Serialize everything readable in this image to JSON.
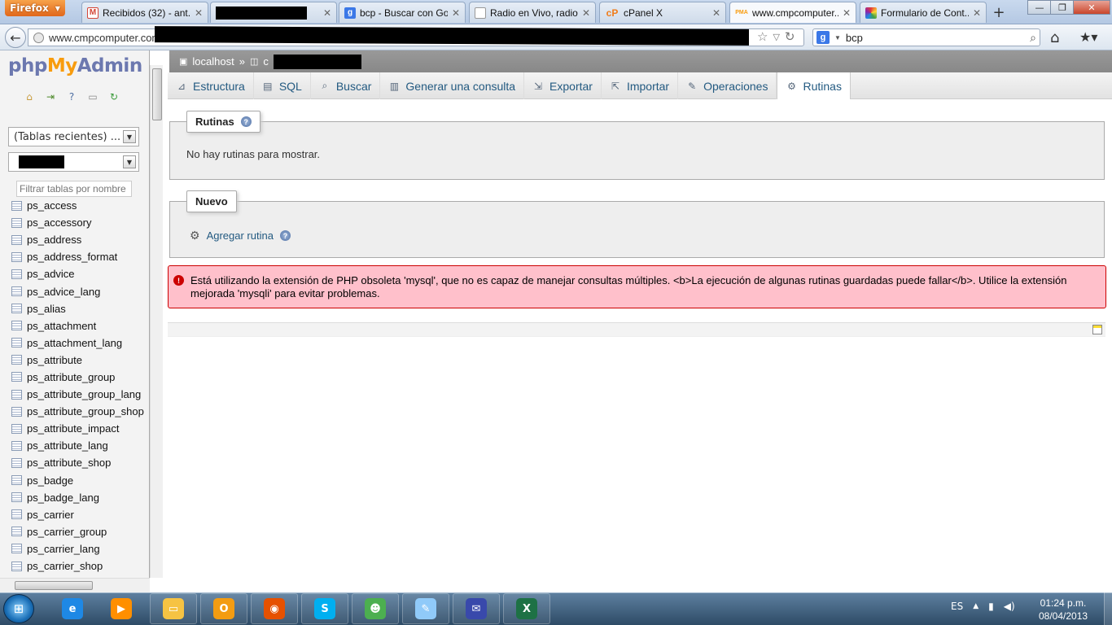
{
  "browser": {
    "menu_label": "Firefox",
    "tabs": [
      {
        "label": "Recibidos (32) - ant...",
        "icon": "gmail-icon",
        "icon_color": "#d44638",
        "icon_glyph": "M"
      },
      {
        "label": "",
        "icon": "redacted",
        "icon_color": "#000000",
        "icon_glyph": ""
      },
      {
        "label": "bcp - Buscar con Go...",
        "icon": "google-icon",
        "icon_color": "#3b78e7",
        "icon_glyph": "g"
      },
      {
        "label": "Radio en Vivo, radio...",
        "icon": "page-icon",
        "icon_color": "#bbbbbb",
        "icon_glyph": ""
      },
      {
        "label": "cPanel X",
        "icon": "cpanel-icon",
        "icon_color": "#f07c1a",
        "icon_glyph": "cP"
      },
      {
        "label": "www.cmpcomputer...",
        "icon": "phpmyadmin-icon",
        "icon_color": "#f89c0e",
        "icon_glyph": "PMA"
      },
      {
        "label": "Formulario de Cont...",
        "icon": "rainbow-icon",
        "icon_color": "#e64a19",
        "icon_glyph": ""
      }
    ],
    "url": "www.cmpcomputer.com",
    "search_value": "bcp",
    "search_engine_glyph": "g"
  },
  "pma": {
    "logo": {
      "php": "php",
      "my": "My",
      "admin": "Admin"
    },
    "recent_tables": "(Tablas recientes) ...",
    "database_select": "",
    "filter_placeholder": "Filtrar tablas por nombre",
    "tables": [
      "ps_access",
      "ps_accessory",
      "ps_address",
      "ps_address_format",
      "ps_advice",
      "ps_advice_lang",
      "ps_alias",
      "ps_attachment",
      "ps_attachment_lang",
      "ps_attribute",
      "ps_attribute_group",
      "ps_attribute_group_lang",
      "ps_attribute_group_shop",
      "ps_attribute_impact",
      "ps_attribute_lang",
      "ps_attribute_shop",
      "ps_badge",
      "ps_badge_lang",
      "ps_carrier",
      "ps_carrier_group",
      "ps_carrier_lang",
      "ps_carrier_shop"
    ],
    "breadcrumb": {
      "server": "localhost",
      "separator": "»",
      "db_prefix": "c"
    },
    "tabs": [
      {
        "label": "Estructura",
        "icon": "structure-icon",
        "glyph": "⊿"
      },
      {
        "label": "SQL",
        "icon": "sql-icon",
        "glyph": "▤"
      },
      {
        "label": "Buscar",
        "icon": "search-icon",
        "glyph": "⌕"
      },
      {
        "label": "Generar una consulta",
        "icon": "query-icon",
        "glyph": "▥"
      },
      {
        "label": "Exportar",
        "icon": "export-icon",
        "glyph": "⇲"
      },
      {
        "label": "Importar",
        "icon": "import-icon",
        "glyph": "⇱"
      },
      {
        "label": "Operaciones",
        "icon": "wrench-icon",
        "glyph": "✎"
      },
      {
        "label": "Rutinas",
        "icon": "routines-icon",
        "glyph": "⚙"
      }
    ],
    "routines_legend": "Rutinas",
    "no_routines": "No hay rutinas para mostrar.",
    "new_legend": "Nuevo",
    "add_routine": "Agregar rutina",
    "error_message": "Está utilizando la extensión de PHP obsoleta 'mysql', que no es capaz de manejar consultas múltiples. <b>La ejecución de algunas rutinas guardadas puede fallar</b>. Utilice la extensión mejorada 'mysqli' para evitar problemas."
  },
  "taskbar": {
    "language": "ES",
    "time": "01:24 p.m.",
    "date": "08/04/2013",
    "apps": [
      {
        "name": "internet-explorer-icon",
        "color": "#1e88e5",
        "glyph": "e"
      },
      {
        "name": "media-player-icon",
        "color": "#ff8f00",
        "glyph": "▶"
      },
      {
        "name": "file-explorer-icon",
        "color": "#f6c343",
        "glyph": "▭"
      },
      {
        "name": "outlook-icon",
        "color": "#f39c12",
        "glyph": "O"
      },
      {
        "name": "firefox-icon",
        "color": "#e65100",
        "glyph": "◉"
      },
      {
        "name": "skype-icon",
        "color": "#00aff0",
        "glyph": "S"
      },
      {
        "name": "messenger-icon",
        "color": "#4caf50",
        "glyph": "☻"
      },
      {
        "name": "notepad-icon",
        "color": "#90caf9",
        "glyph": "✎"
      },
      {
        "name": "windows-messenger-icon",
        "color": "#3949ab",
        "glyph": "✉"
      },
      {
        "name": "excel-icon",
        "color": "#1e7145",
        "glyph": "X"
      }
    ]
  }
}
